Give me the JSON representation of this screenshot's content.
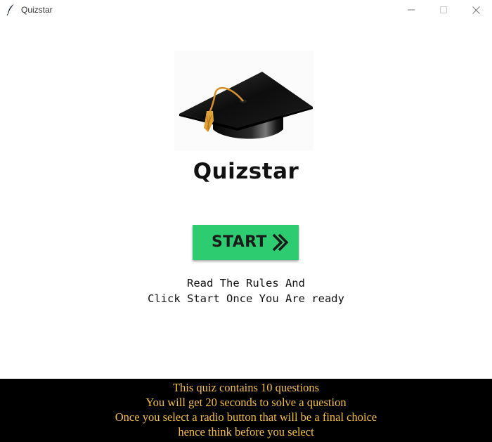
{
  "window": {
    "title": "Quizstar",
    "icon": "feather-icon",
    "controls": [
      "minimize-icon",
      "maximize-icon",
      "close-icon"
    ]
  },
  "logo": {
    "icon": "graduation-cap-icon"
  },
  "app_title": "Quizstar",
  "start_button": {
    "label": "START",
    "icon": "double-chevron-right-icon",
    "color": "#2ecc71"
  },
  "instructions": {
    "line1": "Read The Rules And",
    "line2": "Click Start Once You Are ready"
  },
  "rules": {
    "text_color": "#f6be3f",
    "background": "#000000",
    "lines": [
      "This quiz contains 10 questions",
      "You will get 20 seconds to solve a question",
      "Once you select a radio button that will be a final choice",
      "hence think before you select"
    ]
  }
}
